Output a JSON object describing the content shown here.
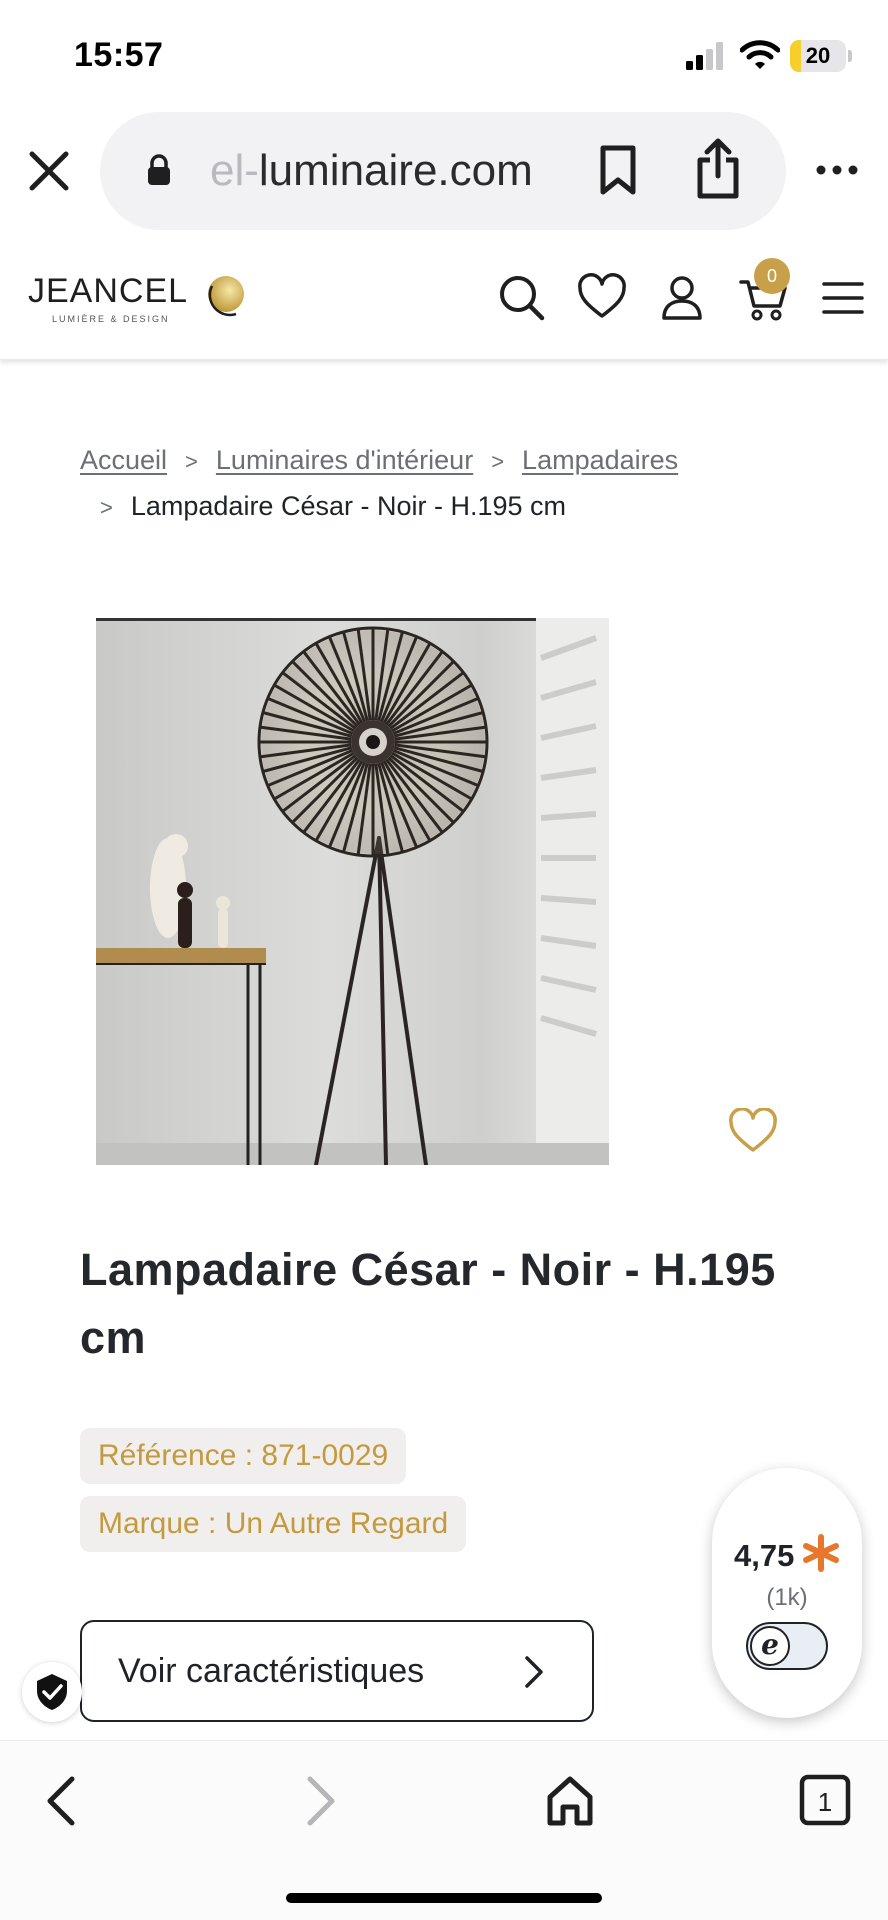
{
  "status_bar": {
    "time": "15:57",
    "battery": "20",
    "battery_level": 0.2
  },
  "browser": {
    "url_faded": "el-",
    "url_main": "luminaire.com"
  },
  "header": {
    "logo_text": "JEANCEL",
    "logo_tagline": "LUMIÈRE & DESIGN",
    "cart_count": "0"
  },
  "breadcrumb": {
    "items": [
      "Accueil",
      "Luminaires d'intérieur",
      "Lampadaires"
    ],
    "separator": ">",
    "current": "Lampadaire César - Noir - H.195 cm"
  },
  "product": {
    "title": "Lampadaire César - Noir - H.195 cm",
    "reference": "Référence : 871-0029",
    "brand": "Marque : Un Autre Regard",
    "characteristics_label": "Voir caractéristiques"
  },
  "rating": {
    "score": "4,75",
    "count": "(1k)",
    "badge_letter": "e"
  },
  "colors": {
    "accent_gold": "#c9a04a",
    "tag_text": "#c49a3e",
    "rating_star": "#e8772e"
  }
}
